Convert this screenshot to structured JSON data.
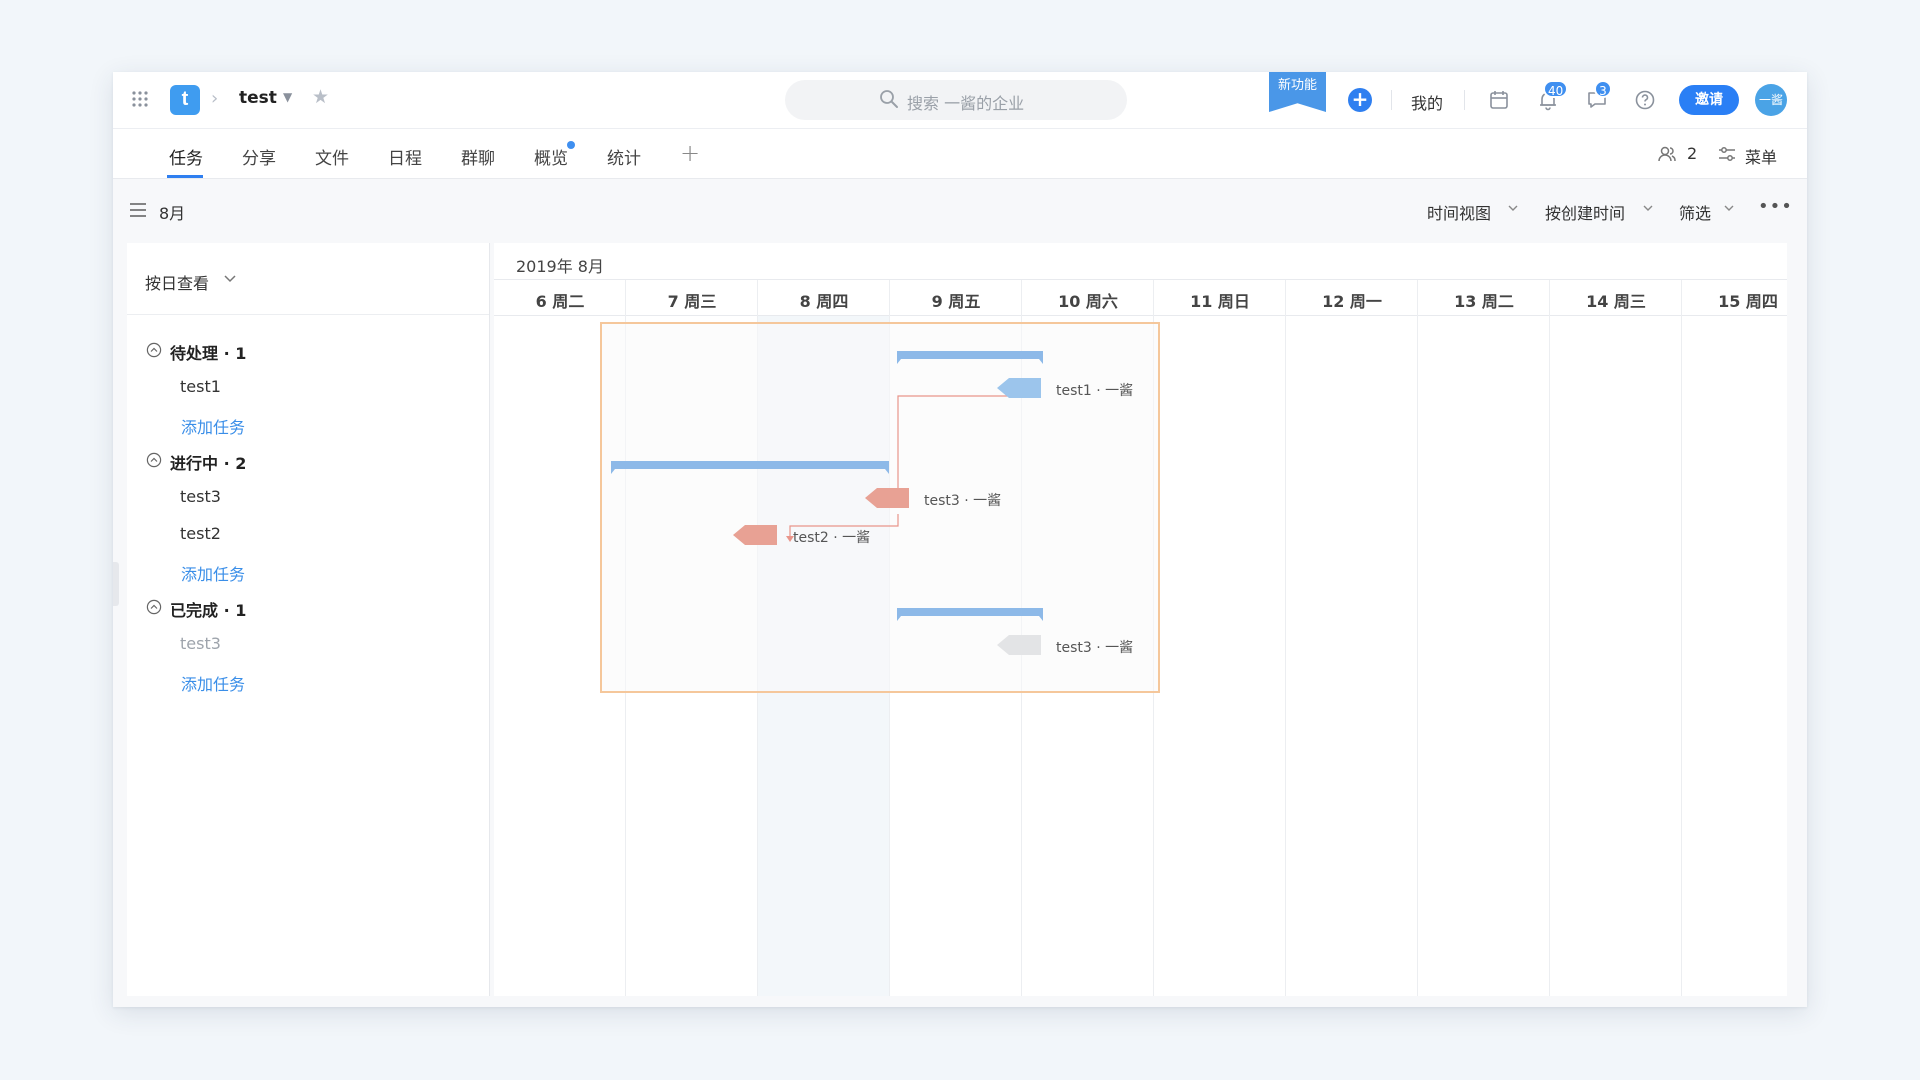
{
  "topbar": {
    "project_name": "test",
    "logo_letter": "t",
    "search_placeholder": "搜索 一酱的企业",
    "new_feature": "新功能",
    "mine": "我的",
    "notifications_count": "40",
    "messages_count": "3",
    "invite": "邀请",
    "avatar_text": "一酱"
  },
  "tabs": [
    "任务",
    "分享",
    "文件",
    "日程",
    "群聊",
    "概览",
    "统计"
  ],
  "tabs_right": {
    "members_count": "2",
    "menu": "菜单"
  },
  "toolbar": {
    "month": "8月",
    "time_view": "时间视图",
    "sort_by": "按创建时间",
    "filter": "筛选"
  },
  "left_panel": {
    "view_by": "按日查看",
    "add_task": "添加任务",
    "groups": [
      {
        "title": "待处理",
        "count": "· 1",
        "tasks": [
          "test1"
        ]
      },
      {
        "title": "进行中",
        "count": "· 2",
        "tasks": [
          "test3",
          "test2"
        ]
      },
      {
        "title": "已完成",
        "count": "· 1",
        "tasks": [
          "test3"
        ]
      }
    ]
  },
  "gantt": {
    "month_label": "2019年 8月",
    "days": [
      "6 周二",
      "7 周三",
      "8 周四",
      "9 周五",
      "10 周六",
      "11 周日",
      "12 周一",
      "13 周二",
      "14 周三",
      "15 周四"
    ],
    "task_labels": [
      "test1 · 一酱",
      "test3 · 一酱",
      "test2 · 一酱",
      "test3 · 一酱"
    ]
  },
  "colors": {
    "accent": "#2f7ff0",
    "bar_blue": "#8db9e8",
    "task_red": "#e8a194",
    "selection_border": "#f5c79b"
  }
}
